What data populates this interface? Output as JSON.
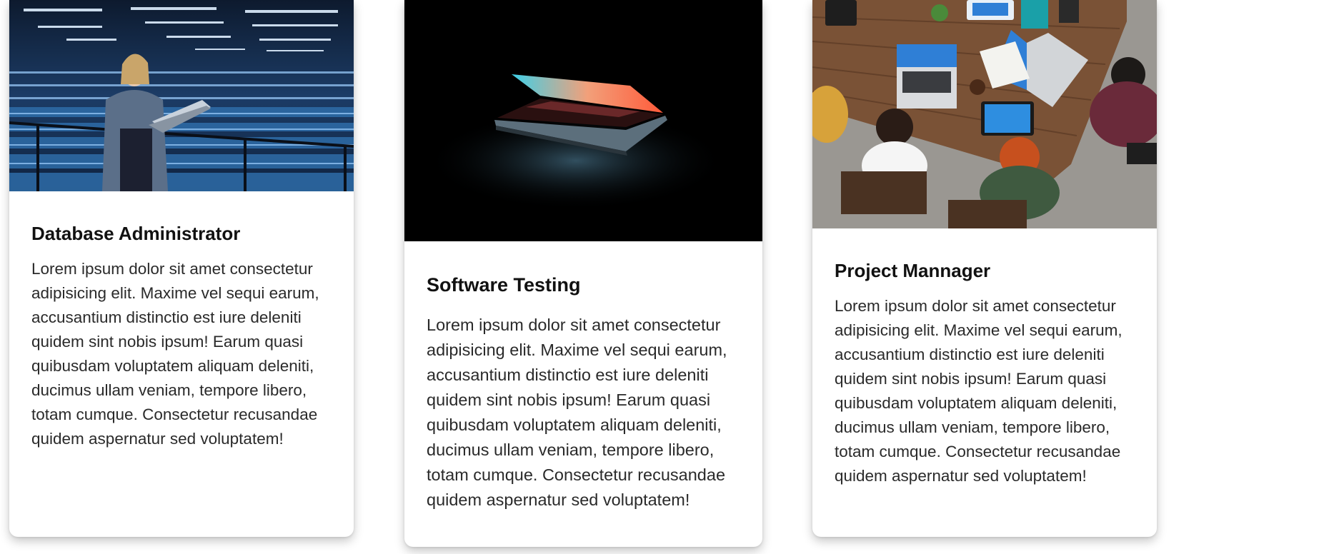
{
  "cards": [
    {
      "title": "Database Administrator",
      "text": "Lorem ipsum dolor sit amet consectetur adipisicing elit. Maxime vel sequi earum, accusantium distinctio est iure deleniti quidem sint nobis ipsum! Earum quasi quibusdam voluptatem aliquam deleniti, ducimus ullam veniam, tempore libero, totam cumque. Consectetur recusandae quidem aspernatur sed voluptatem!",
      "image": "data-center-photo"
    },
    {
      "title": "Software Testing",
      "text": "Lorem ipsum dolor sit amet consectetur adipisicing elit. Maxime vel sequi earum, accusantium distinctio est iure deleniti quidem sint nobis ipsum! Earum quasi quibusdam voluptatem aliquam deleniti, ducimus ullam veniam, tempore libero, totam cumque. Consectetur recusandae quidem aspernatur sed voluptatem!",
      "image": "laptop-glow-photo"
    },
    {
      "title": "Project Mannager",
      "text": "Lorem ipsum dolor sit amet consectetur adipisicing elit. Maxime vel sequi earum, accusantium distinctio est iure deleniti quidem sint nobis ipsum! Earum quasi quibusdam voluptatem aliquam deleniti, ducimus ullam veniam, tempore libero, totam cumque. Consectetur recusandae quidem aspernatur sed voluptatem!",
      "image": "team-meeting-photo"
    }
  ],
  "colors": {
    "card_bg": "#ffffff",
    "title": "#111111",
    "text": "#2a2a2a",
    "data_center_blue": "#1f4a7a",
    "laptop_bg": "#000000",
    "table_wood": "#7a5236"
  }
}
